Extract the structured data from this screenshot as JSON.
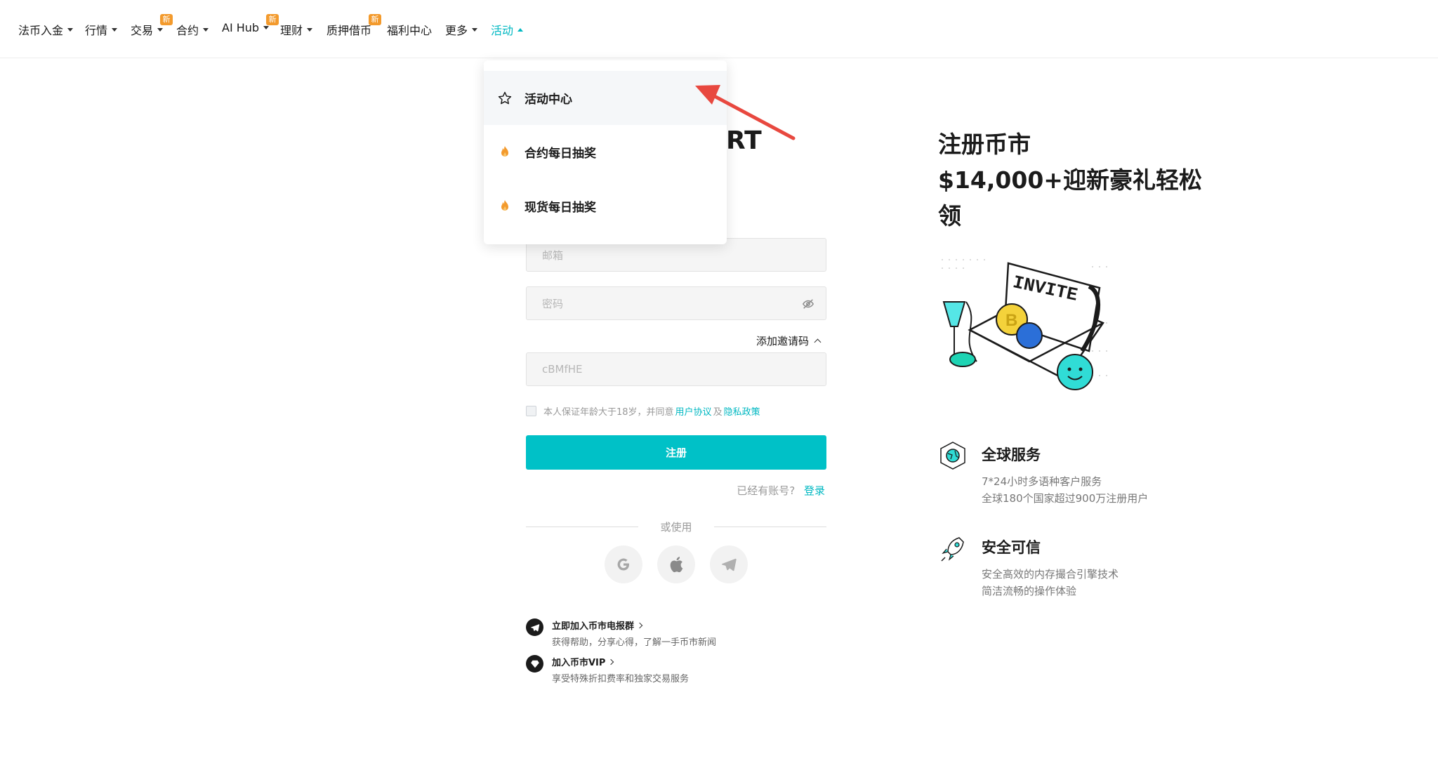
{
  "nav": {
    "items": [
      {
        "label": "法币入金",
        "has_caret": true,
        "badge": ""
      },
      {
        "label": "行情",
        "has_caret": true,
        "badge": ""
      },
      {
        "label": "交易",
        "has_caret": true,
        "badge": "新"
      },
      {
        "label": "合约",
        "has_caret": true,
        "badge": ""
      },
      {
        "label": "AI Hub",
        "has_caret": true,
        "badge": "新"
      },
      {
        "label": "理财",
        "has_caret": true,
        "badge": ""
      },
      {
        "label": "质押借币",
        "has_caret": false,
        "badge": "新"
      },
      {
        "label": "福利中心",
        "has_caret": false,
        "badge": ""
      },
      {
        "label": "更多",
        "has_caret": true,
        "badge": ""
      },
      {
        "label": "活动",
        "has_caret": true,
        "badge": "",
        "active": true
      }
    ]
  },
  "dropdown": {
    "items": [
      {
        "label": "活动中心",
        "icon": "star-icon"
      },
      {
        "label": "合约每日抽奖",
        "icon": "flame-icon"
      },
      {
        "label": "现货每日抽奖",
        "icon": "flame-icon"
      }
    ]
  },
  "form": {
    "heading_fragment": "RT",
    "email_placeholder": "邮箱",
    "password_placeholder": "密码",
    "invite_toggle": "添加邀请码",
    "invite_code_value": "cBMfHE",
    "agree_prefix": "本人保证年龄大于18岁，并同意",
    "user_agreement": "用户协议",
    "and": "及",
    "privacy_policy": "隐私政策",
    "register_label": "注册",
    "have_account": "已经有账号?",
    "login_link": "登录",
    "or_use": "或使用"
  },
  "promos": [
    {
      "title": "立即加入币市电报群",
      "sub": "获得帮助，分享心得，了解一手币市新闻",
      "icon": "telegram-icon"
    },
    {
      "title": "加入币市VIP",
      "sub": "享受特殊折扣费率和独家交易服务",
      "icon": "vip-diamond-icon"
    }
  ],
  "right": {
    "heading_line1": "注册币市",
    "heading_line2": "$14,000+迎新豪礼轻松",
    "heading_line3": "领",
    "illustration_text": "INVITE",
    "features": [
      {
        "title": "全球服务",
        "lines": [
          "7*24小时多语种客户服务",
          "全球180个国家超过900万注册用户"
        ],
        "icon": "globe-icon"
      },
      {
        "title": "安全可信",
        "lines": [
          "安全高效的内存撮合引擎技术",
          "简洁流畅的操作体验"
        ],
        "icon": "rocket-icon"
      }
    ]
  },
  "colors": {
    "accent": "#00c1c7",
    "badge": "#f39a2c",
    "arrow": "#e8483f"
  }
}
